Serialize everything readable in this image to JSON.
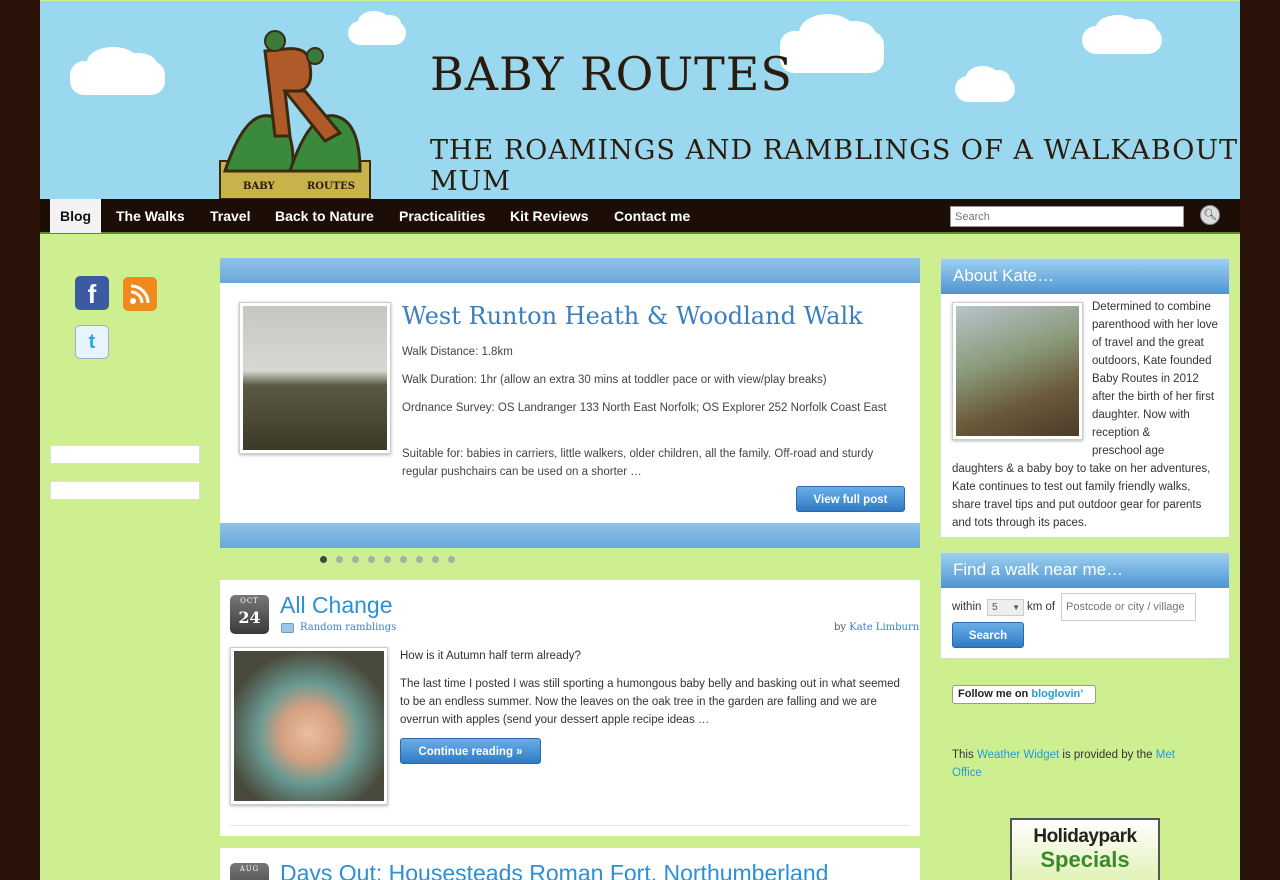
{
  "header": {
    "title": "BABY ROUTES",
    "tagline": "THE ROAMINGS AND RAMBLINGS OF A WALKABOUT MUM",
    "logo_text": "BABY ROUTES"
  },
  "nav": {
    "items": [
      {
        "label": "Blog",
        "active": true
      },
      {
        "label": "The Walks"
      },
      {
        "label": "Travel"
      },
      {
        "label": "Back to Nature"
      },
      {
        "label": "Practicalities"
      },
      {
        "label": "Kit Reviews"
      },
      {
        "label": "Contact me"
      }
    ],
    "search_placeholder": "Search"
  },
  "social": {
    "facebook": "f",
    "twitter": "t"
  },
  "slider": {
    "title": "West Runton Heath & Woodland Walk",
    "lines": [
      "Walk Distance: 1.8km",
      "Walk Duration: 1hr (allow an extra 30 mins at toddler pace or with view/play breaks)",
      "Ordnance Survey: OS Landranger 133 North East Norfolk; OS Explorer 252 Norfolk Coast East",
      "Suitable for: babies in carriers, little walkers, older children, all the family. Off-road and sturdy regular pushchairs can be used on a shorter …"
    ],
    "button": "View full post",
    "dots_total": 9,
    "dots_active": 1
  },
  "posts": [
    {
      "month": "OCT",
      "day": "24",
      "title": "All Change",
      "category": "Random ramblings",
      "author_prefix": "by",
      "author": "Kate Limburn",
      "paragraphs": [
        "How is it Autumn half term already?",
        "The last time I posted I was still sporting a humongous baby belly and basking out in what seemed to be an endless summer. Now the leaves on the oak tree in the garden are falling and we are overrun with apples (send your dessert apple recipe ideas …"
      ],
      "button": "Continue reading »"
    },
    {
      "month": "AUG",
      "title": "Days Out: Housesteads Roman Fort, Northumberland"
    }
  ],
  "about": {
    "title": "About Kate…",
    "text_right": "Determined to combine parenthood with her love of travel and the great outdoors, Kate founded Baby Routes in 2012 after the birth of her first daughter. Now with reception &",
    "text_right2": "preschool age",
    "text_full": "daughters & a baby boy to take on her adventures, Kate continues to test out family friendly walks, share travel tips and put outdoor gear for parents and tots through its paces."
  },
  "find_walk": {
    "title": "Find a walk near me…",
    "within": "within",
    "km_value": "5",
    "km_of": "km of",
    "postcode_placeholder": "Postcode or city / village",
    "button": "Search"
  },
  "bloglovin": {
    "prefix": "Follow me on",
    "brand": "bloglovin’"
  },
  "weather": {
    "this": "This",
    "link1": "Weather Widget",
    "middle": "is provided by the",
    "link2": "Met Office"
  },
  "holiday": {
    "line1": "Holidaypark",
    "line2": "Specials"
  },
  "colors": {
    "accent_blue": "#2d8fd8",
    "nav_bg": "#1c0e07",
    "page_green": "#cdef8f",
    "header_sky": "#99d8ee"
  }
}
